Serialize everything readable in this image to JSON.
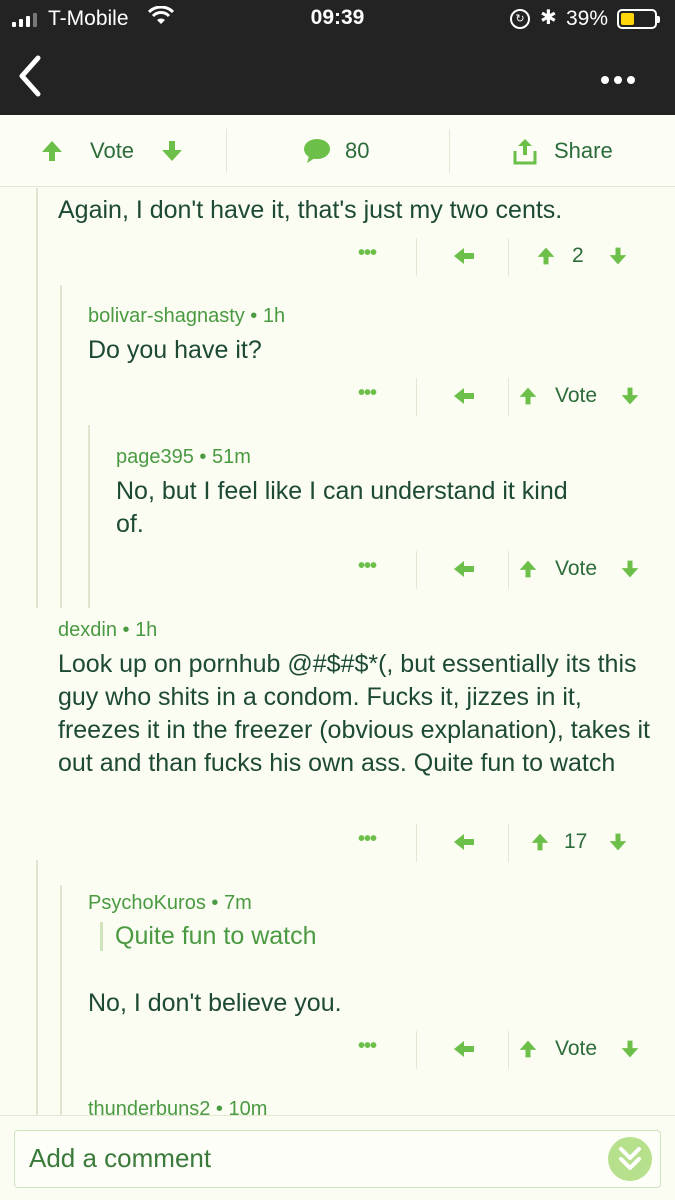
{
  "status": {
    "carrier": "T-Mobile",
    "time": "09:39",
    "battery": "39%"
  },
  "votebar": {
    "vote_label": "Vote",
    "comment_count": "80",
    "share_label": "Share"
  },
  "comments": [
    {
      "author": "",
      "age": "",
      "text": "Again, I don't have it, that's just my two cents.",
      "score": "2"
    },
    {
      "author": "bolivar-shagnasty",
      "age": "1h",
      "text": "Do you have it?",
      "score": "Vote"
    },
    {
      "author": "page395",
      "age": "51m",
      "text": "No, but I feel like I can understand it kind of.",
      "score": "Vote"
    },
    {
      "author": "dexdin",
      "age": "1h",
      "text": "Look up on pornhub @#$#$*(, but essentially its this guy who shits in a condom. Fucks it, jizzes in it, freezes it in the freezer (obvious explanation), takes it out and than fucks his own ass. Quite fun to watch",
      "score": "17"
    },
    {
      "author": "PsychoKuros",
      "age": "7m",
      "quote": "Quite fun to watch",
      "text": "No, I don't believe you.",
      "score": "Vote"
    },
    {
      "author": "thunderbuns2",
      "age": "10m"
    }
  ],
  "composer": {
    "placeholder": "Add a comment"
  },
  "colors": {
    "accent": "#6cc04a",
    "text": "#1d4a32",
    "meta": "#4a9a42",
    "background": "#fbfcf2",
    "topbar": "#232323"
  }
}
